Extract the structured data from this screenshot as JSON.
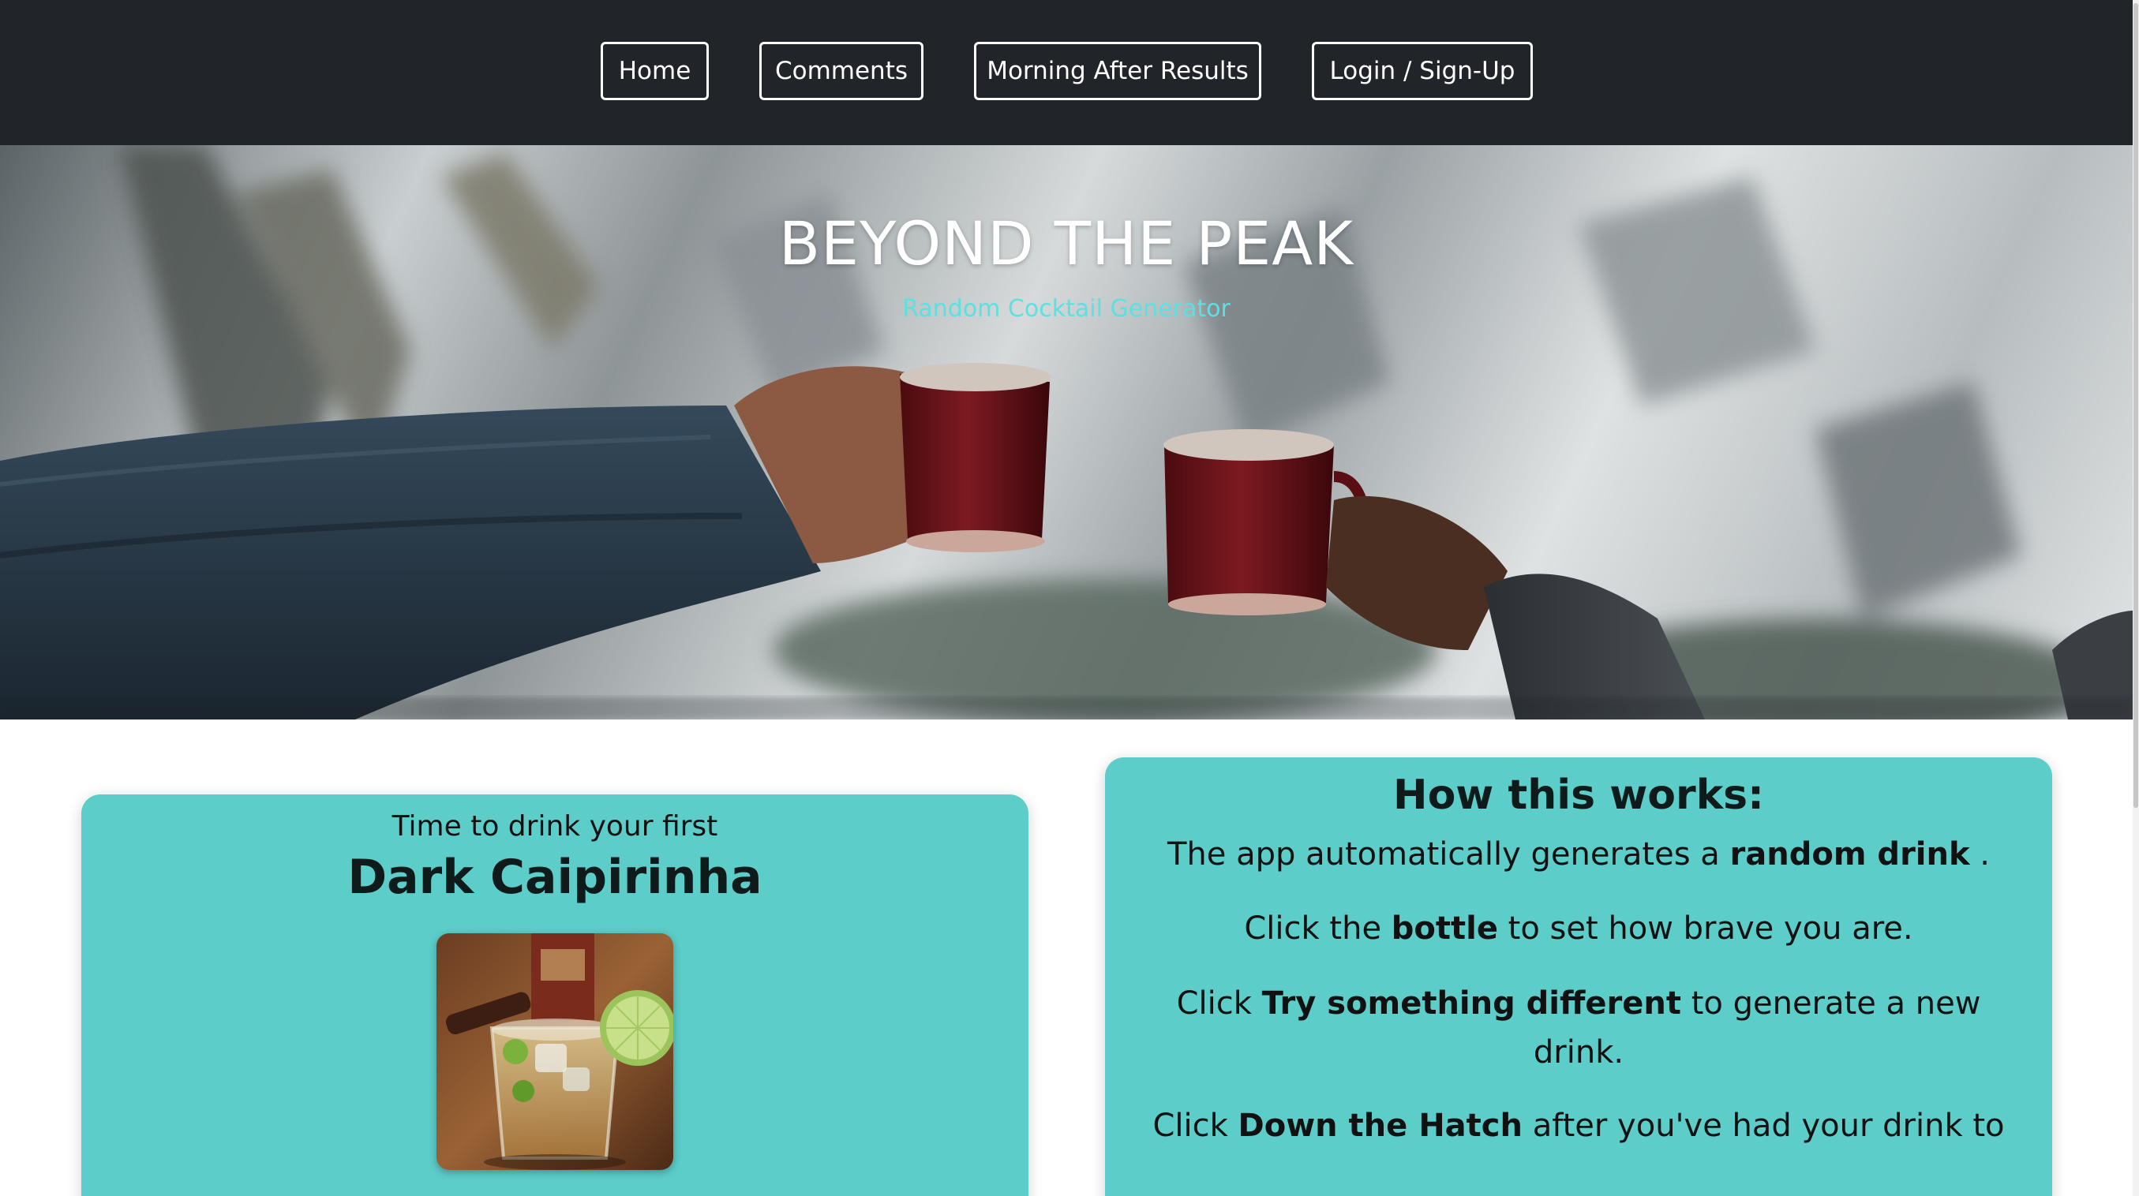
{
  "nav": {
    "items": [
      {
        "label": "Home"
      },
      {
        "label": "Comments"
      },
      {
        "label": "Morning After Results"
      },
      {
        "label": "Login / Sign-Up"
      }
    ]
  },
  "hero": {
    "title": "BEYOND THE PEAK",
    "subtitle": "Random Cocktail Generator"
  },
  "drink_card": {
    "pre_title": "Time to drink your first",
    "drink_name": "Dark Caipirinha"
  },
  "how_card": {
    "title": "How this works:",
    "line1": {
      "pre": "The app automatically generates a ",
      "bold": "random drink",
      "post": " ."
    },
    "line2": {
      "pre": "Click the ",
      "bold": "bottle",
      "post": " to set how brave you are."
    },
    "line3": {
      "pre": "Click ",
      "bold": "Try something different",
      "post": " to generate a new drink."
    },
    "line4": {
      "pre": "Click ",
      "bold": "Down the Hatch",
      "post": " after you've had your drink to"
    }
  },
  "colors": {
    "nav_bg": "#212429",
    "card_bg": "#5ccdc9",
    "subtitle_accent": "#5ce0e0"
  }
}
